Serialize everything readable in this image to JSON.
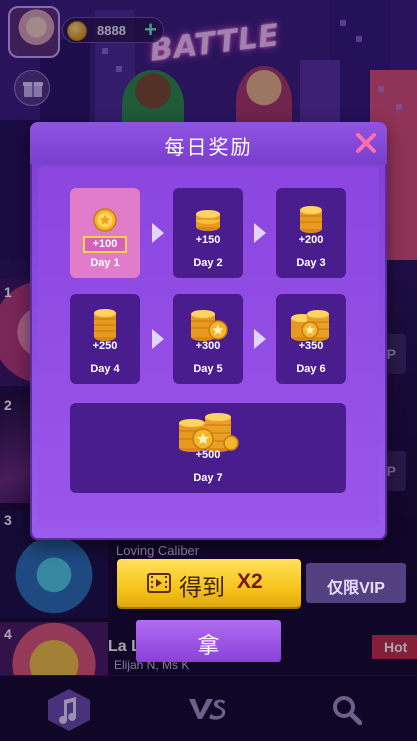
{
  "top_bar": {
    "coins": "8888"
  },
  "background": {
    "sign_text": "BATTLE",
    "rows": [
      {
        "rank": "1",
        "vip": "VIP"
      },
      {
        "rank": "2",
        "vip": "VIP"
      },
      {
        "rank": "3",
        "title": "Loving Caliber"
      },
      {
        "rank": "4",
        "title": "La L",
        "artist": "Elijah N, Ms K",
        "tag": "Hot"
      }
    ]
  },
  "dialog": {
    "title": "每日奖励",
    "days": [
      {
        "reward": "+100",
        "label": "Day 1",
        "state": "claimable"
      },
      {
        "reward": "+150",
        "label": "Day 2",
        "state": "locked"
      },
      {
        "reward": "+200",
        "label": "Day 3",
        "state": "locked"
      },
      {
        "reward": "+250",
        "label": "Day 4",
        "state": "locked"
      },
      {
        "reward": "+300",
        "label": "Day 5",
        "state": "locked"
      },
      {
        "reward": "+350",
        "label": "Day 6",
        "state": "locked"
      },
      {
        "reward": "+500",
        "label": "Day 7",
        "state": "locked"
      }
    ]
  },
  "actions": {
    "double_label": "得到",
    "double_multiplier": "X2",
    "vip_only": "仅限VIP",
    "claim_label": "拿"
  },
  "colors": {
    "dialog_purple": "#8a4ae0",
    "card_purple": "#4a1d8f",
    "claimable_pink": "#e07cc9",
    "gold": "#f6c51b"
  }
}
